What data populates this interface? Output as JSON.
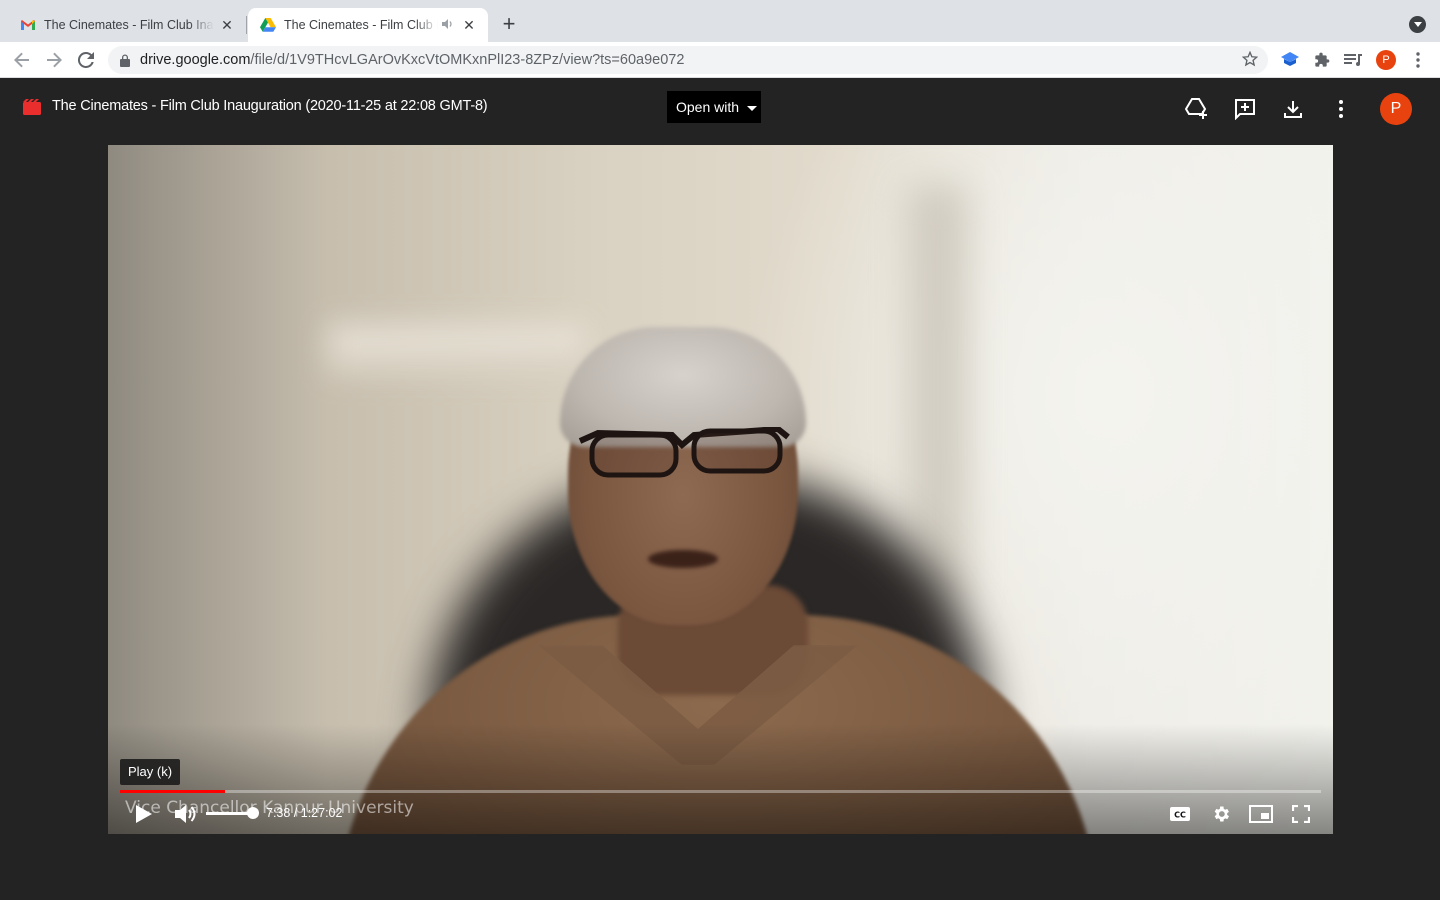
{
  "browser": {
    "tabs": [
      {
        "title": "The Cinemates - Film Club Inauguration",
        "favicon": "gmail-icon"
      },
      {
        "title": "The Cinemates - Film Club Inauguration",
        "favicon": "google-drive-icon"
      }
    ],
    "url_domain": "drive.google.com",
    "url_path": "/file/d/1V9THcvLGArOvKxcVtOMKxnPlI23-8ZPz/view?ts=60a9e072",
    "profile_initial": "P"
  },
  "viewer": {
    "file_title": "The Cinemates - Film Club Inauguration (2020-11-25 at 22:08 GMT-8)",
    "open_with_label": "Open with",
    "avatar_initial": "P"
  },
  "player": {
    "tooltip": "Play (k)",
    "caption": "Vice Chancellor Kanpur University",
    "current_time": "7:38",
    "duration": "1:27:02",
    "time_display": "7:38 / 1:27:02",
    "progress_fraction": 0.0877,
    "volume_fraction": 1.0
  },
  "colors": {
    "tabstrip": "#dee1e6",
    "viewer_bg": "#232323",
    "accent_red": "#ff0000",
    "avatar": "#e8430f"
  }
}
